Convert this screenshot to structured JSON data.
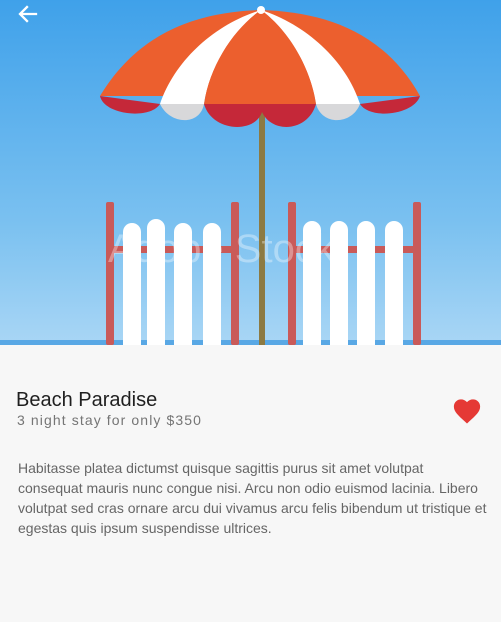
{
  "header": {
    "back_icon": "arrow-left-icon"
  },
  "hero": {
    "watermark_text": "Adobe Stock"
  },
  "listing": {
    "title": "Beach Paradise",
    "subtitle": "3 night stay for only $350",
    "favorite_icon": "heart-icon",
    "favorited": true,
    "description": "Habitasse platea dictumst quisque sagittis purus sit amet volutpat consequat mauris nunc congue nisi. Arcu non odio euismod lacinia. Libero volutpat sed cras ornare arcu dui vivamus arcu felis bibendum ut tristique et egestas quis ipsum suspendisse ultrices."
  },
  "colors": {
    "sky": "#4aa7e8",
    "umbrella_red": "#e85d2f",
    "fence_post": "#c95a59",
    "heart": "#e53935",
    "title_text": "#1f1f1f",
    "body_text": "#666666"
  }
}
